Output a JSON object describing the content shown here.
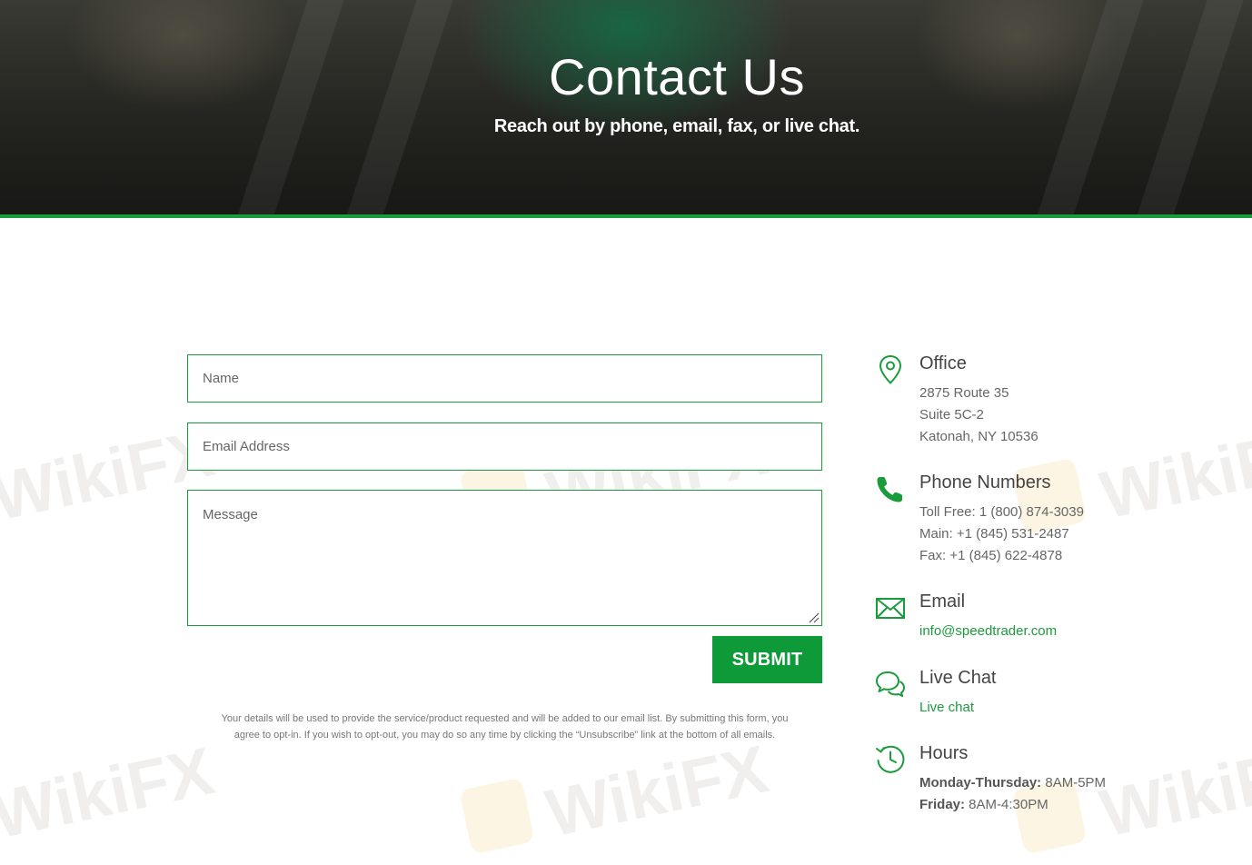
{
  "hero": {
    "title": "Contact Us",
    "subtitle": "Reach out by phone, email, fax, or live chat."
  },
  "form": {
    "name_placeholder": "Name",
    "email_placeholder": "Email Address",
    "message_placeholder": "Message",
    "submit_label": "SUBMIT",
    "disclaimer_line1": "Your details will be used to provide the service/product requested and will be added to our email list. By submitting this form, you",
    "disclaimer_line2": "agree to opt-in. If you wish to opt-out, you may do so any time by clicking the “Unsubscribe” link at the bottom of all emails."
  },
  "contact": {
    "office": {
      "heading": "Office",
      "icon": "map-pin-icon",
      "line1": "2875 Route 35",
      "line2": "Suite 5C-2",
      "line3": "Katonah, NY 10536"
    },
    "phone": {
      "heading": "Phone Numbers",
      "icon": "phone-icon",
      "toll_free": "Toll Free: 1 (800) 874-3039",
      "main": "Main: +1 (845) 531-2487",
      "fax": "Fax: +1 (845) 622-4878"
    },
    "email": {
      "heading": "Email",
      "icon": "envelope-icon",
      "address": "info@speedtrader.com"
    },
    "chat": {
      "heading": "Live Chat",
      "icon": "chat-bubbles-icon",
      "link": "Live chat"
    },
    "hours": {
      "heading": "Hours",
      "icon": "clock-history-icon",
      "mon_thu_label": "Monday-Thursday:",
      "mon_thu_value": " 8AM-5PM",
      "fri_label": "Friday:",
      "fri_value": " 8AM-4:30PM"
    }
  },
  "watermark": {
    "text": "WikiFX"
  },
  "colors": {
    "accent": "#1a9b3c",
    "button": "#0f9a3a",
    "text": "#666666"
  }
}
